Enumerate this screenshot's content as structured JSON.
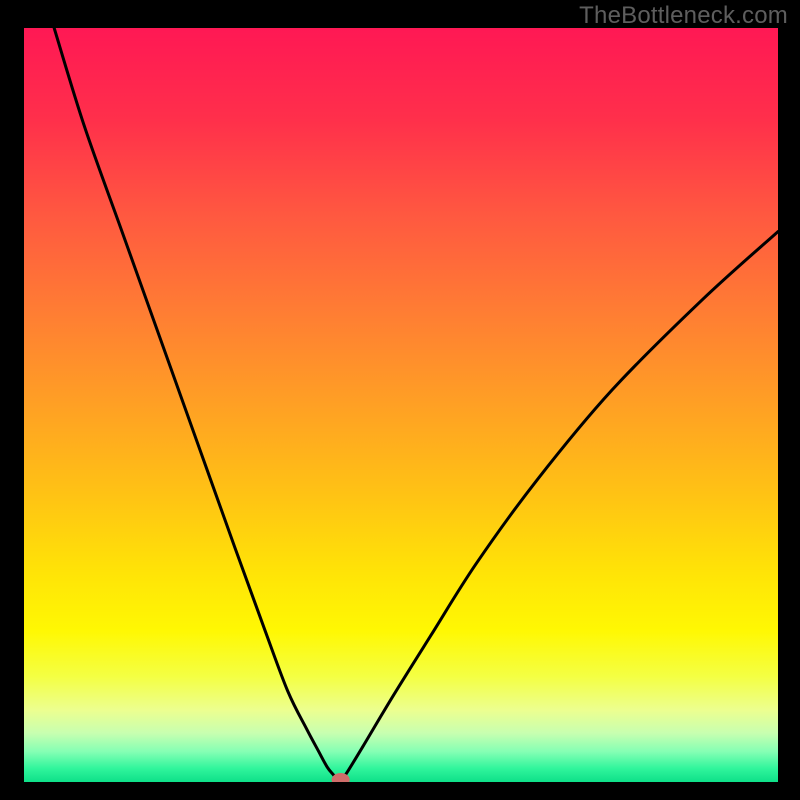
{
  "watermark": "TheBottleneck.com",
  "chart_data": {
    "type": "line",
    "title": "",
    "xlabel": "",
    "ylabel": "",
    "xlim": [
      0,
      100
    ],
    "ylim": [
      0,
      100
    ],
    "series": [
      {
        "name": "curve",
        "x": [
          4,
          8,
          13,
          18,
          23,
          28,
          32,
          35,
          37.5,
          39,
          40.2,
          41,
          41.6,
          42.2,
          42.8,
          45,
          49,
          54,
          60,
          68,
          78,
          90,
          100
        ],
        "y": [
          100,
          87,
          73,
          59,
          45,
          31,
          20,
          12,
          7,
          4.2,
          2.0,
          1.0,
          0.4,
          0.5,
          1.2,
          4.8,
          11.5,
          19.5,
          29,
          40,
          52,
          64,
          73
        ]
      }
    ],
    "marker": {
      "x": 42.0,
      "y": 0.3,
      "rx": 1.2,
      "ry": 0.9,
      "color": "#cf6d6a"
    },
    "gradient_stops": [
      {
        "offset": 0.0,
        "color": "#ff1854"
      },
      {
        "offset": 0.12,
        "color": "#ff2f4b"
      },
      {
        "offset": 0.25,
        "color": "#ff5940"
      },
      {
        "offset": 0.38,
        "color": "#ff7e33"
      },
      {
        "offset": 0.5,
        "color": "#ffa024"
      },
      {
        "offset": 0.62,
        "color": "#ffc314"
      },
      {
        "offset": 0.72,
        "color": "#ffe307"
      },
      {
        "offset": 0.8,
        "color": "#fff803"
      },
      {
        "offset": 0.86,
        "color": "#f4ff43"
      },
      {
        "offset": 0.905,
        "color": "#ecff90"
      },
      {
        "offset": 0.935,
        "color": "#c8ffb0"
      },
      {
        "offset": 0.96,
        "color": "#84ffb4"
      },
      {
        "offset": 0.982,
        "color": "#30f59c"
      },
      {
        "offset": 1.0,
        "color": "#0ee089"
      }
    ]
  }
}
